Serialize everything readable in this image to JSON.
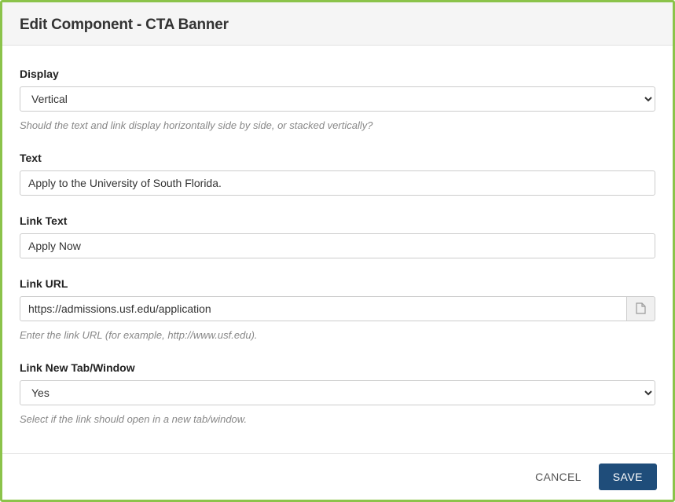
{
  "header": {
    "title": "Edit Component - CTA Banner"
  },
  "fields": {
    "display": {
      "label": "Display",
      "value": "Vertical",
      "help": "Should the text and link display horizontally side by side, or stacked vertically?"
    },
    "text": {
      "label": "Text",
      "value": "Apply to the University of South Florida."
    },
    "linkText": {
      "label": "Link Text",
      "value": "Apply Now"
    },
    "linkUrl": {
      "label": "Link URL",
      "value": "https://admissions.usf.edu/application",
      "help": "Enter the link URL (for example, http://www.usf.edu)."
    },
    "linkNewTab": {
      "label": "Link New Tab/Window",
      "value": "Yes",
      "help": "Select if the link should open in a new tab/window."
    }
  },
  "footer": {
    "cancelLabel": "CANCEL",
    "saveLabel": "SAVE"
  }
}
